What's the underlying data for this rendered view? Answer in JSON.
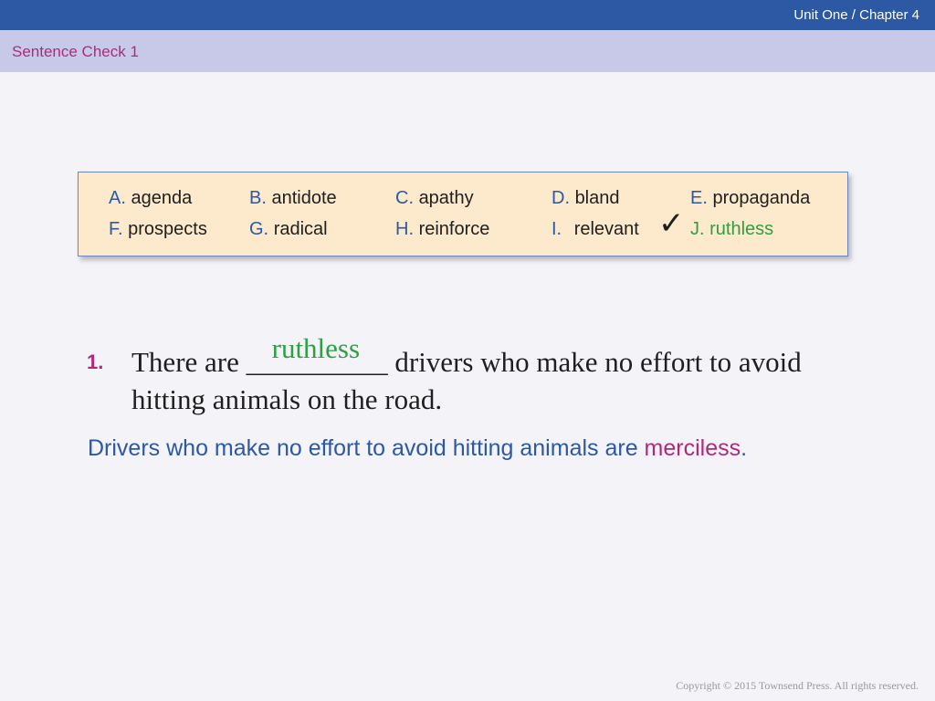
{
  "header": {
    "chapter": "Unit One / Chapter 4",
    "section_title": "Sentence Check 1"
  },
  "word_bank": [
    {
      "letter": "A.",
      "word": "agenda"
    },
    {
      "letter": "B.",
      "word": "antidote"
    },
    {
      "letter": "C.",
      "word": "apathy"
    },
    {
      "letter": "D.",
      "word": "bland"
    },
    {
      "letter": "E.",
      "word": "propaganda"
    },
    {
      "letter": "F.",
      "word": "prospects"
    },
    {
      "letter": "G.",
      "word": "radical"
    },
    {
      "letter": "H.",
      "word": "reinforce"
    },
    {
      "letter": "I.",
      "word": "relevant"
    },
    {
      "letter": "J.",
      "word": "ruthless"
    }
  ],
  "check_mark": "✓",
  "question": {
    "number": "1.",
    "before": "There are ",
    "blank": "__________",
    "answer": "ruthless",
    "after": " drivers who make no effort to avoid hitting animals on the road."
  },
  "explanation": {
    "before": "Drivers who make no effort to avoid hitting animals are ",
    "highlight": "merciless",
    "after": "."
  },
  "footer": {
    "copyright": "Copyright © 2015 Townsend Press. All rights reserved."
  },
  "colors": {
    "header_bar": "#2d58a3",
    "sub_bar": "#c8c8e8",
    "accent_magenta": "#b02a7c",
    "word_box": "#fde9cb",
    "correct_green": "#2ea043"
  }
}
